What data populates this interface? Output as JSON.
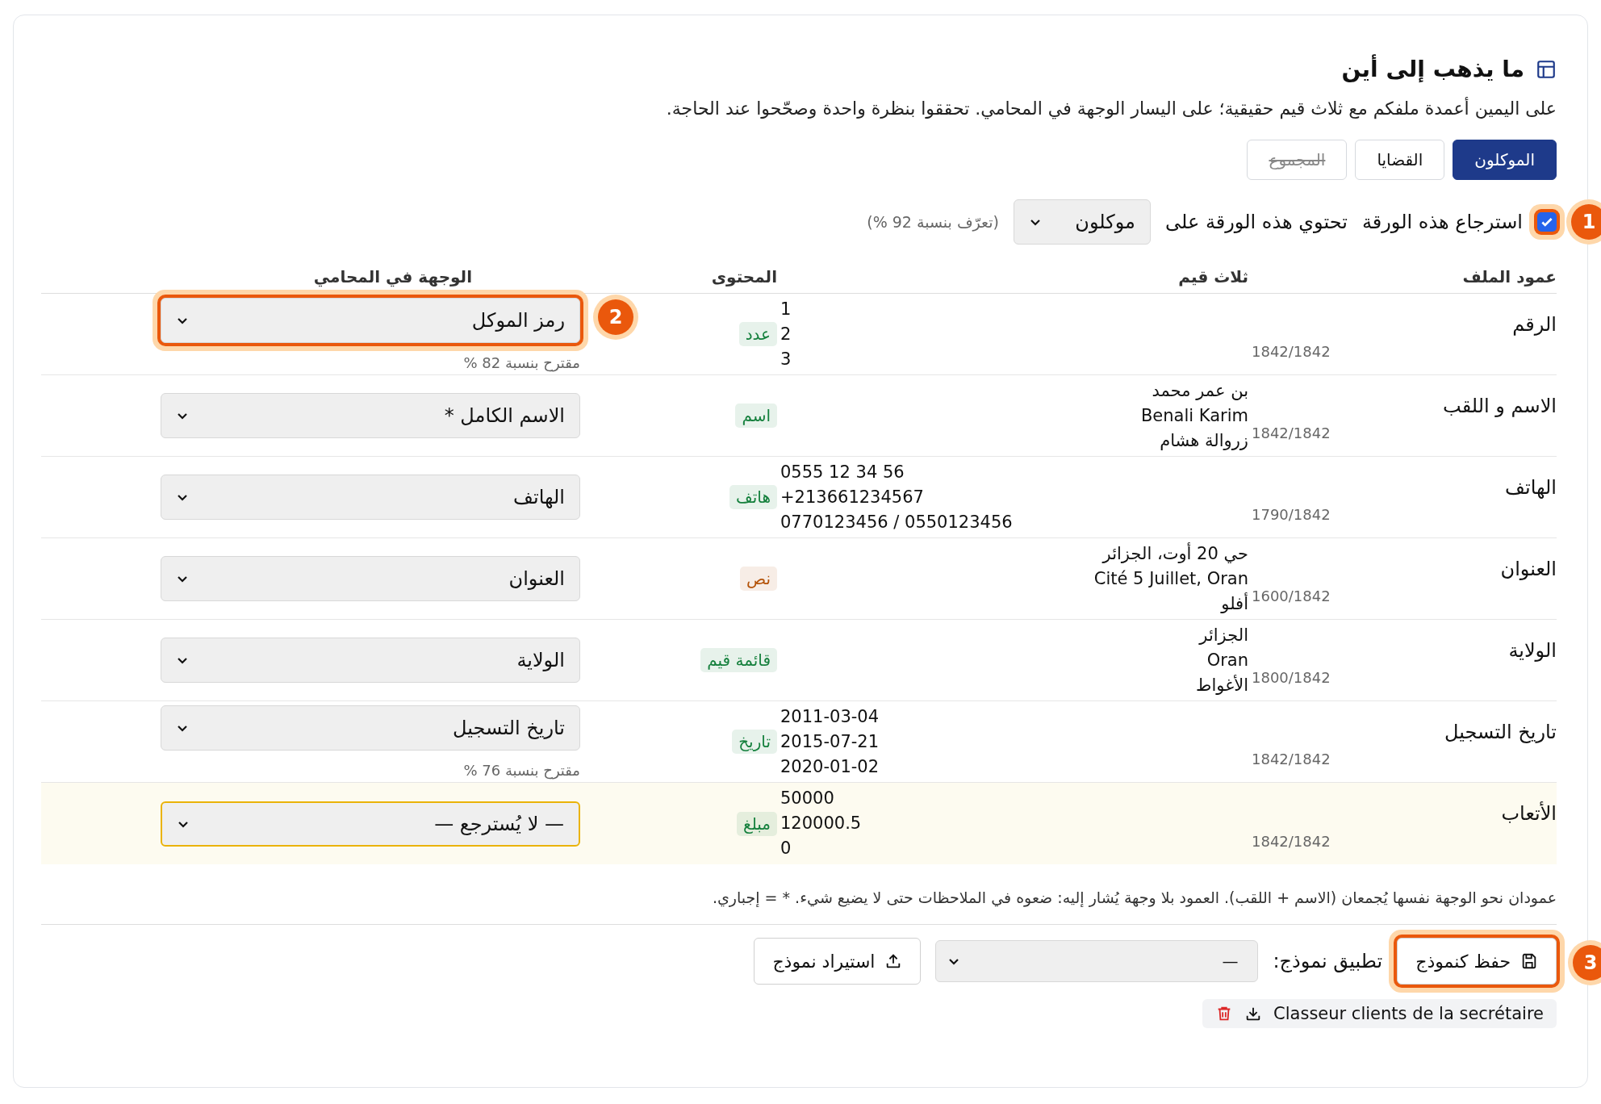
{
  "header": {
    "title": "ما يذهب إلى أين",
    "description": "على اليمين أعمدة ملفكم مع ثلاث قيم حقيقية؛ على اليسار الوجهة في المحامي. تحققوا بنظرة واحدة وصحّحوا عند الحاجة."
  },
  "tabs": [
    {
      "label": "الموكلون",
      "selected": true,
      "disabled": false
    },
    {
      "label": "القضايا",
      "selected": false,
      "disabled": false
    },
    {
      "label": "المجموع",
      "selected": false,
      "disabled": true
    }
  ],
  "sheet": {
    "import_checked": true,
    "import_label": "استرجاع هذه الورقة",
    "callout": "1",
    "contains_label": "تحتوي هذه الورقة على",
    "contains_value": "موكلون",
    "confidence": "(تعرّف بنسبة 92 %)"
  },
  "table": {
    "columns": [
      "عمود الملف",
      "ثلاث قيم",
      "المحتوى",
      "الوجهة في المحامي"
    ],
    "rows": [
      {
        "name": "الرقم",
        "count": "1842/1842",
        "values": [
          "1",
          "2",
          "3"
        ],
        "badge": {
          "label": "عدد",
          "color": "#15803d"
        },
        "target": "رمز الموكل",
        "hint": "مقترح بنسبة 82 %",
        "callout": "2",
        "highlighted": false
      },
      {
        "name": "الاسم و اللقب",
        "count": "1842/1842",
        "values": [
          "بن عمر محمد",
          "Benali Karim",
          "زروالة هشام"
        ],
        "badge": {
          "label": "اسم",
          "color": "#15803d"
        },
        "target": "الاسم الكامل *",
        "highlighted": false
      },
      {
        "name": "الهاتف",
        "count": "1790/1842",
        "values": [
          "0555 12 34 56",
          "+213661234567",
          "0770123456 / 0550123456"
        ],
        "badge": {
          "label": "هاتف",
          "color": "#15803d"
        },
        "target": "الهاتف",
        "highlighted": false
      },
      {
        "name": "العنوان",
        "count": "1600/1842",
        "values": [
          "حي 20 أوت، الجزائر",
          "Cité 5 Juillet, Oran",
          "أفلو"
        ],
        "badge": {
          "label": "نص",
          "color": "#b45309"
        },
        "target": "العنوان",
        "highlighted": false
      },
      {
        "name": "الولاية",
        "count": "1800/1842",
        "values": [
          "الجزائر",
          "Oran",
          "الأغواط"
        ],
        "badge": {
          "label": "قائمة قيم",
          "color": "#15803d"
        },
        "target": "الولاية",
        "highlighted": false
      },
      {
        "name": "تاريخ التسجيل",
        "count": "1842/1842",
        "values": [
          "2011-03-04",
          "2015-07-21",
          "2020-01-02"
        ],
        "badge": {
          "label": "تاريخ",
          "color": "#15803d"
        },
        "target": "تاريخ التسجيل",
        "hint": "مقترح بنسبة 76 %",
        "highlighted": false
      },
      {
        "name": "الأتعاب",
        "count": "1842/1842",
        "values": [
          "50000",
          "120000.5",
          "0"
        ],
        "badge": {
          "label": "مبلغ",
          "color": "#15803d"
        },
        "target": "— لا يُسترجع —",
        "highlighted": true
      }
    ]
  },
  "note": "عمودان نحو الوجهة نفسها يُجمعان (الاسم + اللقب). العمود بلا وجهة يُشار إليه: ضعوه في الملاحظات حتى لا يضيع شيء. * = إجباري.",
  "footer": {
    "save_label": "حفظ كنموذج",
    "save_callout": "3",
    "apply_label": "تطبيق نموذج:",
    "apply_value": "—",
    "import_label": "استيراد نموذج",
    "file_name": "Classeur clients de la secrétaire"
  }
}
